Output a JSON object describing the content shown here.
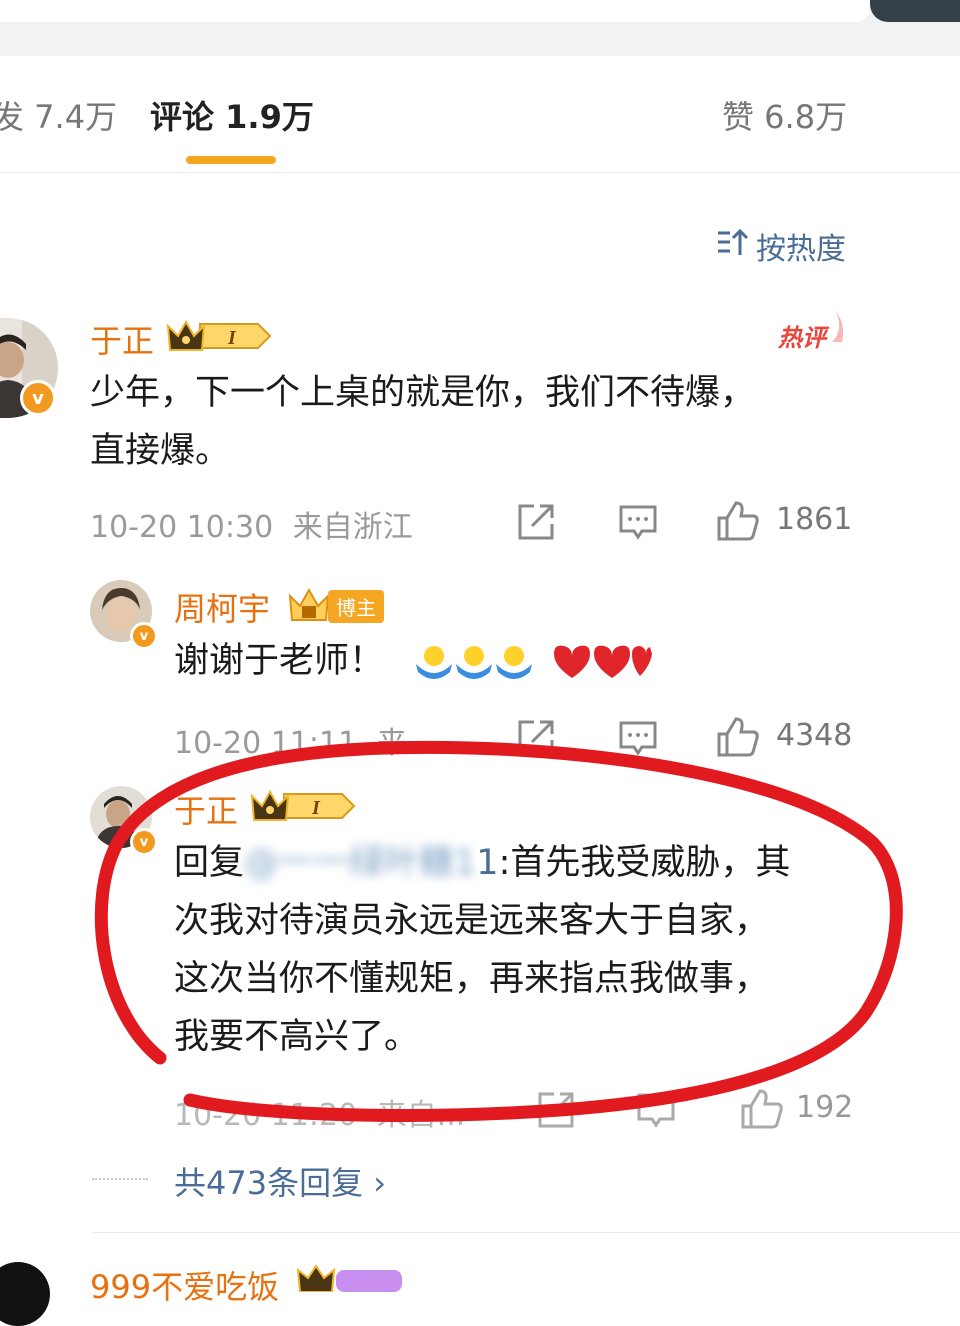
{
  "tabs": {
    "repost": "发 7.4万",
    "comment": "评论 1.9万",
    "like": "赞 6.8万"
  },
  "sort": {
    "label": "按热度"
  },
  "comments": [
    {
      "user": "于正",
      "hot_badge": "热评",
      "text_line1": "少年，下一个上桌的就是你，我们不待爆，",
      "text_line2": "直接爆。",
      "time": "10-20 10:30",
      "location": "来自浙江",
      "likes": "1861"
    },
    {
      "user": "周柯宇",
      "tag": "博主",
      "text": "谢谢于老师！",
      "time": "10-20 11:11",
      "location": "来",
      "likes": "4348"
    },
    {
      "user": "于正",
      "reply_prefix": "回复",
      "reply_target": "@一一绿叶糖1",
      "reply_target_visible": "1",
      "line1_rest": ":首先我受威胁，其",
      "line2": "次我对待演员永远是远来客大于自家，",
      "line3": "这次当你不懂规矩，再来指点我做事，",
      "line4": "我要不高兴了。",
      "time": "10-20 11:20",
      "location": "来自...",
      "likes": "192"
    }
  ],
  "more_replies": "共473条回复 ›",
  "next_user": "999不爱吃饭",
  "colors": {
    "accent_orange": "#f6a623",
    "username_orange": "#e8710f",
    "link_blue": "#4a6c96",
    "annotation_red": "#e01a1f"
  }
}
